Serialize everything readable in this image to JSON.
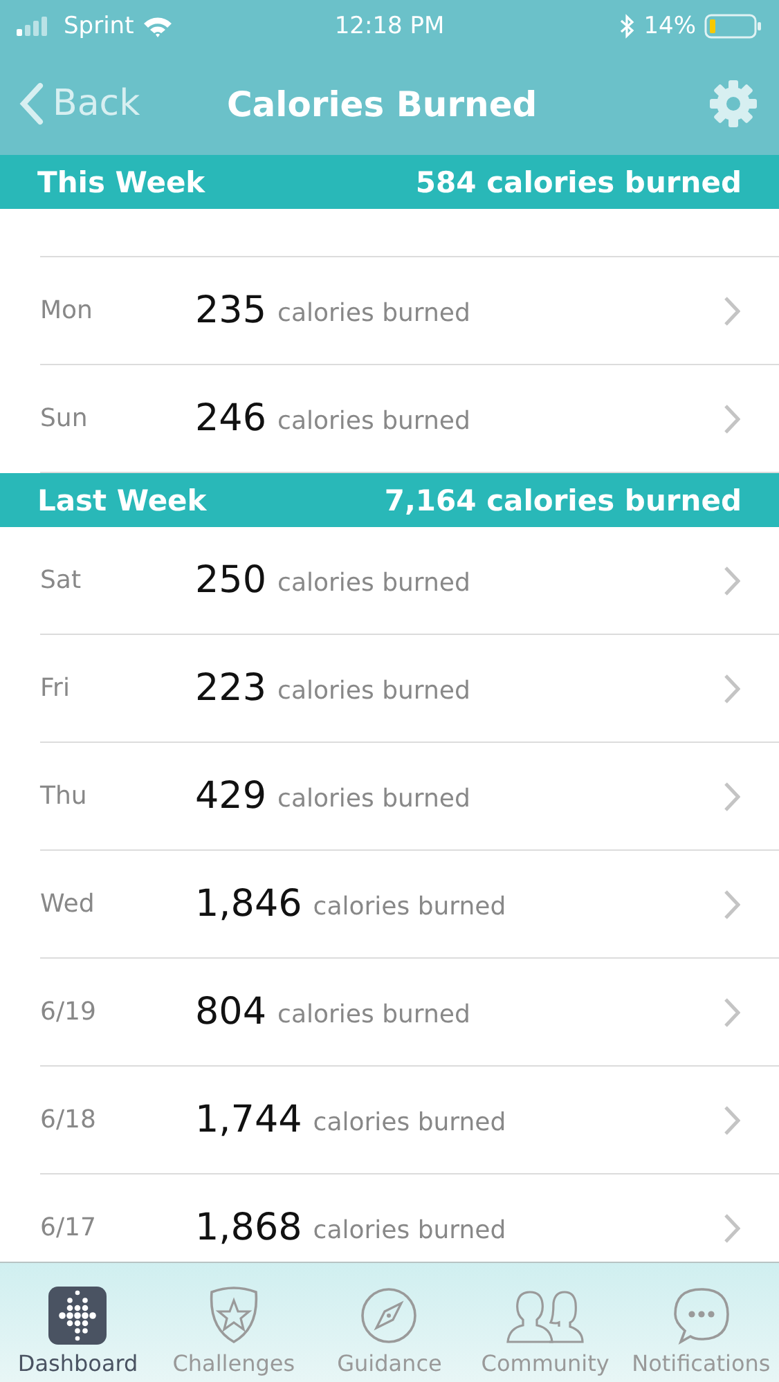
{
  "status_bar": {
    "carrier": "Sprint",
    "time": "12:18 PM",
    "battery": "14%"
  },
  "nav": {
    "back": "Back",
    "title": "Calories Burned"
  },
  "sections": [
    {
      "title": "This Week",
      "total": "584 calories burned",
      "rows": [
        {
          "day": "Mon",
          "value": "235",
          "unit": "calories burned"
        },
        {
          "day": "Sun",
          "value": "246",
          "unit": "calories burned"
        }
      ]
    },
    {
      "title": "Last Week",
      "total": "7,164 calories burned",
      "rows": [
        {
          "day": "Sat",
          "value": "250",
          "unit": "calories burned"
        },
        {
          "day": "Fri",
          "value": "223",
          "unit": "calories burned"
        },
        {
          "day": "Thu",
          "value": "429",
          "unit": "calories burned"
        },
        {
          "day": "Wed",
          "value": "1,846",
          "unit": "calories burned"
        },
        {
          "day": "6/19",
          "value": "804",
          "unit": "calories burned"
        },
        {
          "day": "6/18",
          "value": "1,744",
          "unit": "calories burned"
        },
        {
          "day": "6/17",
          "value": "1,868",
          "unit": "calories burned"
        }
      ]
    }
  ],
  "tabs": [
    {
      "kind": "dashboard",
      "label": "Dashboard",
      "selected": true
    },
    {
      "kind": "challenges",
      "label": "Challenges",
      "selected": false
    },
    {
      "kind": "guidance",
      "label": "Guidance",
      "selected": false
    },
    {
      "kind": "community",
      "label": "Community",
      "selected": false
    },
    {
      "kind": "notifications",
      "label": "Notifications",
      "selected": false
    }
  ]
}
